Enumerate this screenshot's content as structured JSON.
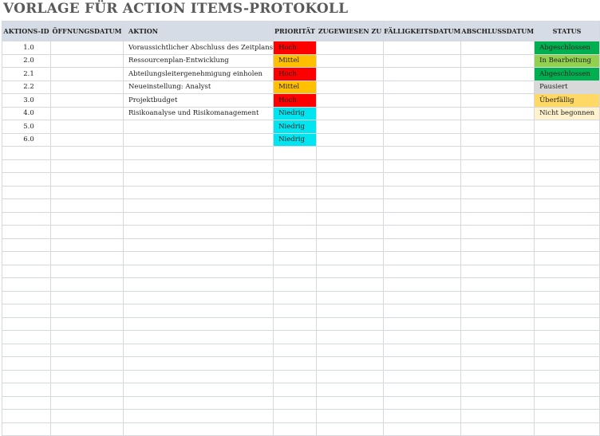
{
  "title": "VORLAGE FÜR ACTION ITEMS-PROTOKOLL",
  "columns": [
    "AKTIONS-ID",
    "ÖFFNUNGSDATUM",
    "AKTION",
    "PRIORITÄT",
    "ZUGEWIESEN ZU",
    "FÄLLIGKEITSDATUM",
    "ABSCHLUSSDATUM",
    "STATUS"
  ],
  "priority_colors": {
    "Hoch": "#ff0000",
    "Mittel": "#ffc000",
    "Niedrig": "#00e5ef"
  },
  "status_colors": {
    "Abgeschlossen": "#00b050",
    "In Bearbeitung": "#92d050",
    "Pausiert": "#d9d9d9",
    "Überfällig": "#ffd966",
    "Nicht begonnen": "#fff2cc"
  },
  "rows": [
    {
      "id": "1.0",
      "opened": "",
      "action": "Voraussichtlicher Abschluss des Zeitplans",
      "priority": "Hoch",
      "assigned": "",
      "due": "",
      "closed": "",
      "status": "Abgeschlossen"
    },
    {
      "id": "2.0",
      "opened": "",
      "action": "Ressourcenplan-Entwicklung",
      "priority": "Mittel",
      "assigned": "",
      "due": "",
      "closed": "",
      "status": "In Bearbeitung"
    },
    {
      "id": "2.1",
      "opened": "",
      "action": "Abteilungsleitergenehmigung einholen",
      "priority": "Hoch",
      "assigned": "",
      "due": "",
      "closed": "",
      "status": "Abgeschlossen"
    },
    {
      "id": "2.2",
      "opened": "",
      "action": "Neueinstellung: Analyst",
      "priority": "Mittel",
      "assigned": "",
      "due": "",
      "closed": "",
      "status": "Pausiert"
    },
    {
      "id": "3.0",
      "opened": "",
      "action": "Projektbudget",
      "priority": "Hoch",
      "assigned": "",
      "due": "",
      "closed": "",
      "status": "Überfällig"
    },
    {
      "id": "4.0",
      "opened": "",
      "action": "Risikoanalyse und Risikomanagement",
      "priority": "Niedrig",
      "assigned": "",
      "due": "",
      "closed": "",
      "status": "Nicht begonnen"
    },
    {
      "id": "5.0",
      "opened": "",
      "action": "",
      "priority": "Niedrig",
      "assigned": "",
      "due": "",
      "closed": "",
      "status": ""
    },
    {
      "id": "6.0",
      "opened": "",
      "action": "",
      "priority": "Niedrig",
      "assigned": "",
      "due": "",
      "closed": "",
      "status": ""
    }
  ]
}
